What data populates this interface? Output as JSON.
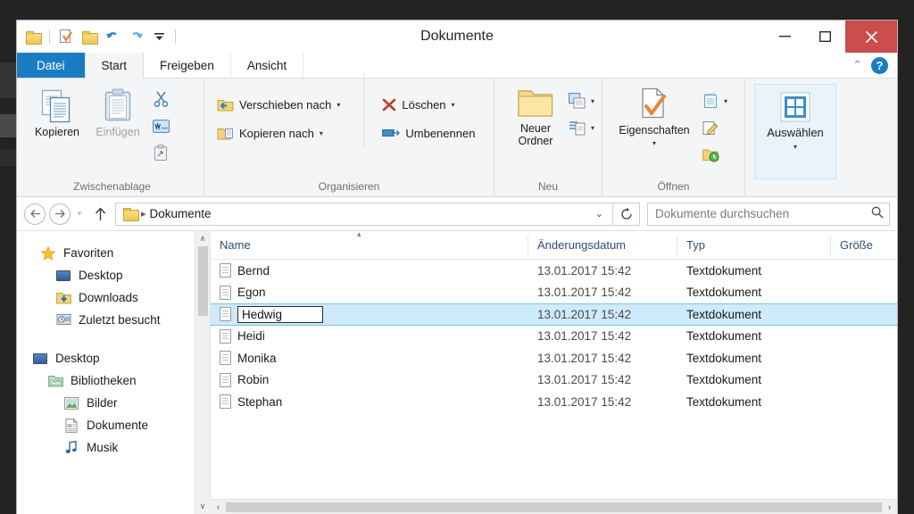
{
  "window": {
    "title": "Dokumente",
    "controls": {
      "minimize": "–",
      "maximize": "❐",
      "close": "✕"
    }
  },
  "quick_access": {
    "items": [
      {
        "name": "folder-properties",
        "icon": "folder-icon"
      },
      {
        "name": "new-folder",
        "icon": "new-folder-icon"
      },
      {
        "name": "undo",
        "icon": "undo-icon",
        "glyph": "↶"
      },
      {
        "name": "redo",
        "icon": "redo-icon",
        "glyph": "↷"
      },
      {
        "name": "customize",
        "icon": "chevron-down-icon",
        "glyph": "⌄"
      }
    ]
  },
  "tabs": [
    {
      "label": "Datei",
      "state": "file"
    },
    {
      "label": "Start",
      "state": "active"
    },
    {
      "label": "Freigeben",
      "state": "normal"
    },
    {
      "label": "Ansicht",
      "state": "normal"
    }
  ],
  "ribbon": {
    "collapse_glyph": "⌃",
    "help_glyph": "?",
    "groups": [
      {
        "label": "Zwischenablage",
        "big_buttons": [
          {
            "label": "Kopieren",
            "enabled": true
          },
          {
            "label": "Einfügen",
            "enabled": false
          }
        ],
        "small_buttons": [
          {
            "name": "cut-icon",
            "glyph": "✂"
          },
          {
            "name": "copy-path-icon",
            "glyph": "▤"
          },
          {
            "name": "paste-shortcut-icon",
            "glyph": "❐"
          }
        ]
      },
      {
        "label": "Organisieren",
        "rows": [
          {
            "label": "Verschieben nach",
            "caret": true
          },
          {
            "label": "Kopieren nach",
            "caret": true
          }
        ],
        "rows2": [
          {
            "label": "Löschen",
            "caret": true
          },
          {
            "label": "Umbenennen",
            "caret": false
          }
        ]
      },
      {
        "label": "Neu",
        "big_buttons": [
          {
            "label": "Neuer\nOrdner",
            "enabled": true
          }
        ],
        "small_buttons": [
          {
            "name": "new-item-icon",
            "glyph": "▤"
          },
          {
            "name": "easy-access-icon",
            "glyph": "▤"
          }
        ]
      },
      {
        "label": "Öffnen",
        "big_buttons": [
          {
            "label": "Eigenschaften",
            "enabled": true,
            "caret": true
          }
        ],
        "small_buttons": [
          {
            "name": "open-with-icon",
            "glyph": "▤"
          },
          {
            "name": "edit-icon",
            "glyph": "✎"
          },
          {
            "name": "history-icon",
            "glyph": "↻"
          }
        ]
      },
      {
        "label": "",
        "select_button": {
          "label": "Auswählen",
          "caret": true,
          "highlighted": true
        }
      }
    ]
  },
  "address_bar": {
    "back_glyph": "←",
    "forward_glyph": "→",
    "recent_glyph": "▾",
    "up_glyph": "↑",
    "breadcrumb": {
      "folder_icon": "folder-icon",
      "sep": "▸",
      "path": "Dokumente"
    },
    "dropdown_glyph": "⌄",
    "refresh_glyph": "↻",
    "search_placeholder": "Dokumente durchsuchen",
    "search_value": "",
    "search_icon": "⌕"
  },
  "sidebar": {
    "groups": [
      {
        "items": [
          {
            "label": "Favoriten",
            "icon": "star-icon",
            "indent": 0
          },
          {
            "label": "Desktop",
            "icon": "monitor-icon",
            "indent": 1
          },
          {
            "label": "Downloads",
            "icon": "downloads-folder-icon",
            "indent": 1
          },
          {
            "label": "Zuletzt besucht",
            "icon": "recent-places-icon",
            "indent": 1
          }
        ]
      },
      {
        "items": [
          {
            "label": "Desktop",
            "icon": "monitor-icon",
            "indent": 0
          },
          {
            "label": "Bibliotheken",
            "icon": "libraries-icon",
            "indent": 1
          },
          {
            "label": "Bilder",
            "icon": "pictures-icon",
            "indent": 2
          },
          {
            "label": "Dokumente",
            "icon": "documents-icon",
            "indent": 2
          },
          {
            "label": "Musik",
            "icon": "music-icon",
            "indent": 2
          }
        ]
      }
    ],
    "scroll_up_glyph": "∧",
    "scroll_down_glyph": "∨"
  },
  "file_list": {
    "columns": [
      {
        "label": "Name",
        "sorted": "asc"
      },
      {
        "label": "Änderungsdatum",
        "sorted": null
      },
      {
        "label": "Typ",
        "sorted": null
      },
      {
        "label": "Größe",
        "sorted": null
      }
    ],
    "sort_arrow": "▴",
    "rows": [
      {
        "name": "Bernd",
        "date": "13.01.2017 15:42",
        "type": "Textdokument",
        "size": "",
        "selected": false,
        "editing": false
      },
      {
        "name": "Egon",
        "date": "13.01.2017 15:42",
        "type": "Textdokument",
        "size": "",
        "selected": false,
        "editing": false
      },
      {
        "name": "Hedwig",
        "date": "13.01.2017 15:42",
        "type": "Textdokument",
        "size": "",
        "selected": true,
        "editing": true
      },
      {
        "name": "Heidi",
        "date": "13.01.2017 15:42",
        "type": "Textdokument",
        "size": "",
        "selected": false,
        "editing": false
      },
      {
        "name": "Monika",
        "date": "13.01.2017 15:42",
        "type": "Textdokument",
        "size": "",
        "selected": false,
        "editing": false
      },
      {
        "name": "Robin",
        "date": "13.01.2017 15:42",
        "type": "Textdokument",
        "size": "",
        "selected": false,
        "editing": false
      },
      {
        "name": "Stephan",
        "date": "13.01.2017 15:42",
        "type": "Textdokument",
        "size": "",
        "selected": false,
        "editing": false
      }
    ],
    "hscroll": {
      "left_glyph": "‹",
      "right_glyph": "›"
    }
  },
  "colors": {
    "accent_blue": "#1a7dc4",
    "selection_blue": "#cfeafa",
    "selection_border": "#7cc3e8",
    "close_red": "#cb4d4d",
    "ribbon_bg": "#f3f5f7",
    "header_text": "#2d4d73"
  }
}
